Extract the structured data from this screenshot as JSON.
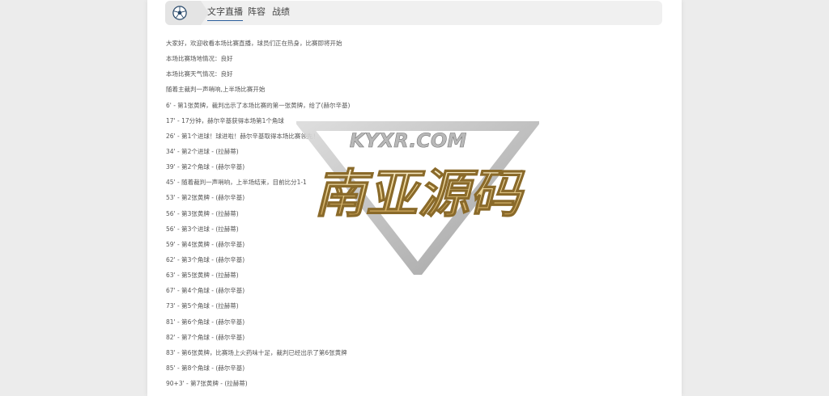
{
  "tabs": [
    {
      "label": "文字直播",
      "active": true
    },
    {
      "label": "阵容",
      "active": false
    },
    {
      "label": "战绩",
      "active": false
    }
  ],
  "events": [
    "大家好，欢迎收看本场比赛直播，球员们正在热身，比赛即将开始",
    "本场比赛场地情况：良好",
    "本场比赛天气情况：良好",
    "随着主裁判一声哨响,上半场比赛开始",
    "6' - 第1张黄牌，裁判出示了本场比赛的第一张黄牌，给了(赫尔辛基)",
    "17' - 17分钟，赫尔辛基获得本场第1个角球",
    "26' - 第1个进球！球进啦！赫尔辛基取得本场比赛领先！",
    "34' - 第2个进球 - (拉赫蒂)",
    "39' - 第2个角球 - (赫尔辛基)",
    "45' - 随着裁判一声哨响，上半场结束，目前比分1-1",
    "53' - 第2张黄牌 - (赫尔辛基)",
    "56' - 第3张黄牌 - (拉赫蒂)",
    "56' - 第3个进球 - (拉赫蒂)",
    "59' - 第4张黄牌 - (赫尔辛基)",
    "62' - 第3个角球 - (赫尔辛基)",
    "63' - 第5张黄牌 - (拉赫蒂)",
    "67' - 第4个角球 - (赫尔辛基)",
    "73' - 第5个角球 - (拉赫蒂)",
    "81' - 第6个角球 - (赫尔辛基)",
    "82' - 第7个角球 - (赫尔辛基)",
    "83' - 第6张黄牌，比赛场上火药味十足，裁判已经出示了第6张黄牌",
    "85' - 第8个角球 - (赫尔辛基)",
    "90+3' - 第7张黄牌 - (拉赫蒂)"
  ],
  "watermark": {
    "site_text": "KYXR.COM",
    "brand_text": "南亚源码"
  },
  "colors": {
    "background": "#ececec",
    "tab_underline": "#2b5e9c"
  },
  "icons": {
    "ball": "soccer-ball-icon"
  }
}
